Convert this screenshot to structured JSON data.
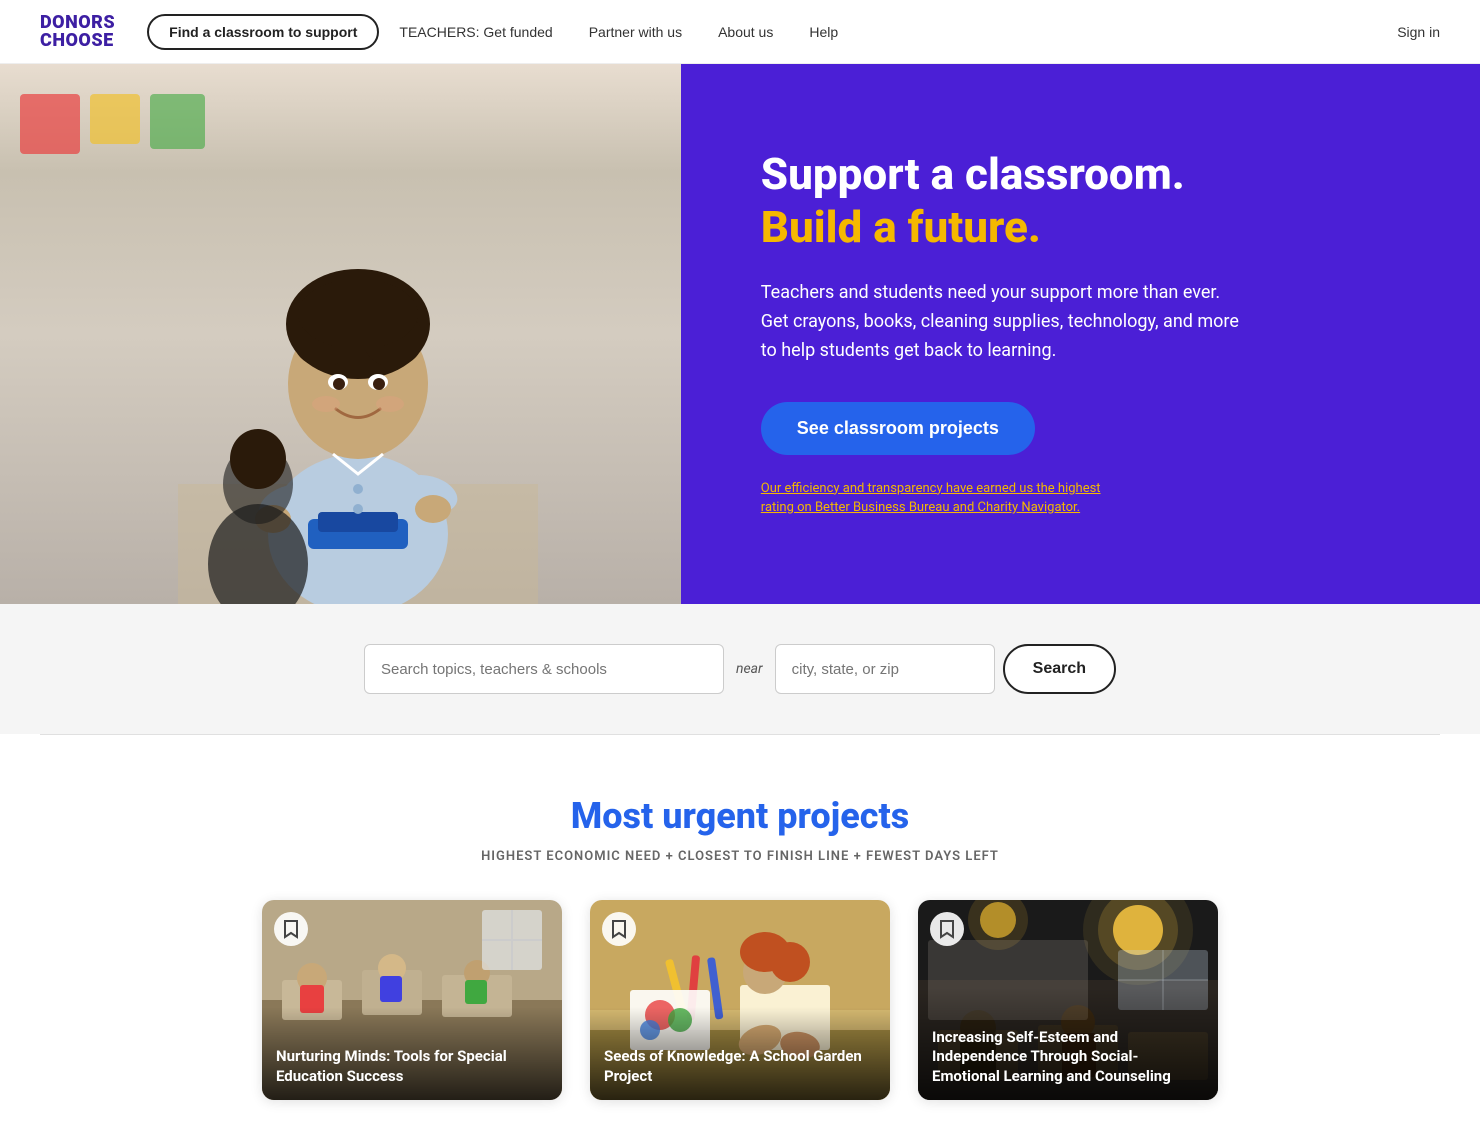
{
  "logo": {
    "line1": "DONORS",
    "line2": "CHOOSE"
  },
  "nav": {
    "find_label": "Find a classroom to support",
    "teachers_label": "TEACHERS: Get funded",
    "partner_label": "Partner with us",
    "about_label": "About us",
    "help_label": "Help",
    "signin_label": "Sign in"
  },
  "hero": {
    "headline_white": "Support a classroom.",
    "headline_yellow": "Build a future.",
    "body": "Teachers and students need your support more than ever. Get crayons, books, cleaning supplies, technology, and more to help students get back to learning.",
    "cta_label": "See classroom projects",
    "trust_text": "Our efficiency and transparency have earned us the highest rating on Better Business Bureau and Charity Navigator."
  },
  "search": {
    "topics_placeholder": "Search topics, teachers & schools",
    "near_label": "near",
    "location_placeholder": "city, state, or zip",
    "button_label": "Search"
  },
  "urgent": {
    "title": "Most urgent projects",
    "subtitle": "HIGHEST ECONOMIC NEED + CLOSEST TO FINISH LINE + FEWEST DAYS LEFT",
    "projects": [
      {
        "title": "Nurturing Minds: Tools for Special Education Success",
        "img_type": "classroom-1"
      },
      {
        "title": "Seeds of Knowledge: A School Garden Project",
        "img_type": "classroom-2"
      },
      {
        "title": "Increasing Self-Esteem and Independence Through Social-Emotional Learning and Counseling",
        "img_type": "classroom-3"
      }
    ]
  }
}
